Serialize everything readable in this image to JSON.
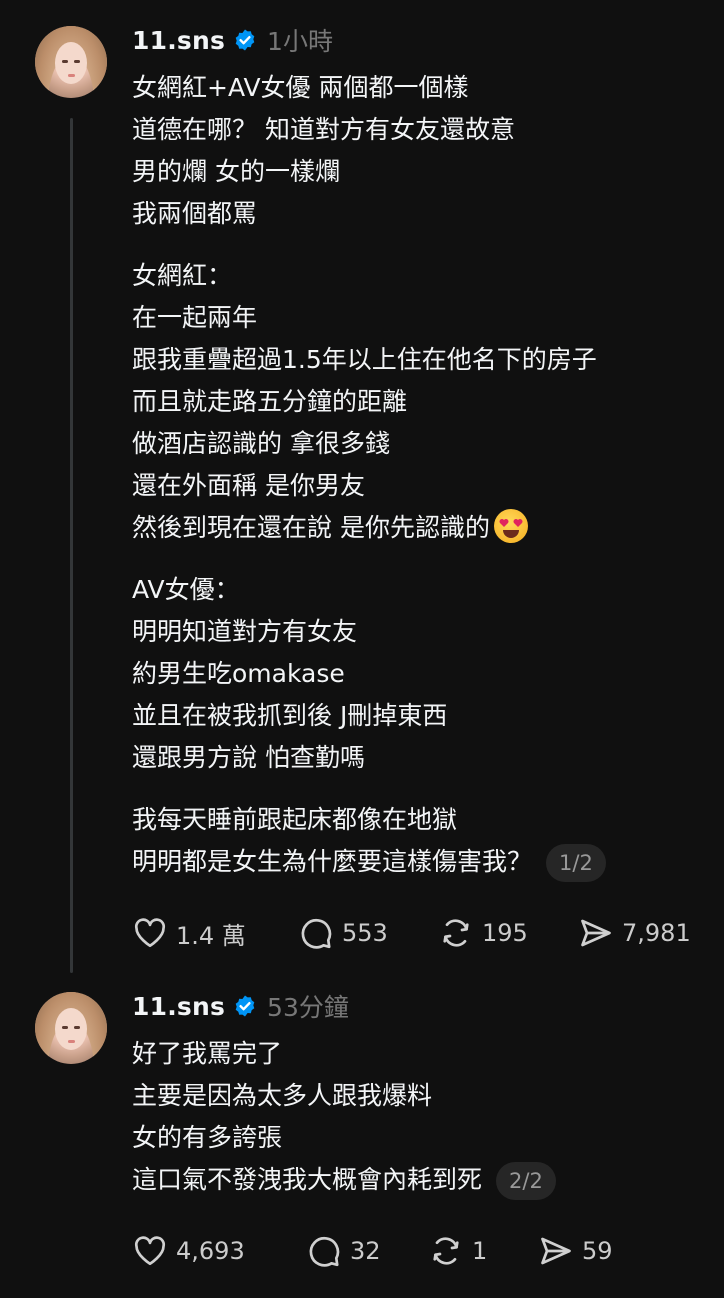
{
  "posts": [
    {
      "username": "11.sns",
      "time": "1小時",
      "badge": "1/2",
      "lines": [
        "女網紅+AV女優 兩個都一個樣",
        "道德在哪？ 知道對方有女友還故意",
        "男的爛 女的一樣爛",
        "我兩個都罵",
        "",
        "女網紅：",
        "在一起兩年",
        "跟我重疊超過1.5年以上住在他名下的房子",
        "而且就走路五分鐘的距離",
        "做酒店認識的 拿很多錢",
        "還在外面稱 是你男友",
        "然後到現在還在說 是你先認識的",
        "",
        "AV女優：",
        "明明知道對方有女友",
        "約男生吃omakase",
        "並且在被我抓到後 J刪掉東西",
        "還跟男方說 怕查勤嗎",
        "",
        "我每天睡前跟起床都像在地獄",
        "明明都是女生為什麼要這樣傷害我？"
      ],
      "likes": "1.4 萬",
      "comments": "553",
      "reposts": "195",
      "shares": "7,981"
    },
    {
      "username": "11.sns",
      "time": "53分鐘",
      "badge": "2/2",
      "lines": [
        "好了我罵完了",
        "主要是因為太多人跟我爆料",
        "女的有多誇張",
        "這口氣不發洩我大概會內耗到死"
      ],
      "likes": "4,693",
      "comments": "32",
      "reposts": "1",
      "shares": "59"
    }
  ],
  "icons": {
    "verified": "verified-badge-icon",
    "like": "heart-icon",
    "comment": "comment-bubble-icon",
    "repost": "repost-icon",
    "share": "send-icon",
    "emoji": "heart-eyes-emoji-icon"
  },
  "colors": {
    "background": "#101010",
    "text": "#f3f5f7",
    "muted": "#777777",
    "verified": "#0095f6"
  }
}
